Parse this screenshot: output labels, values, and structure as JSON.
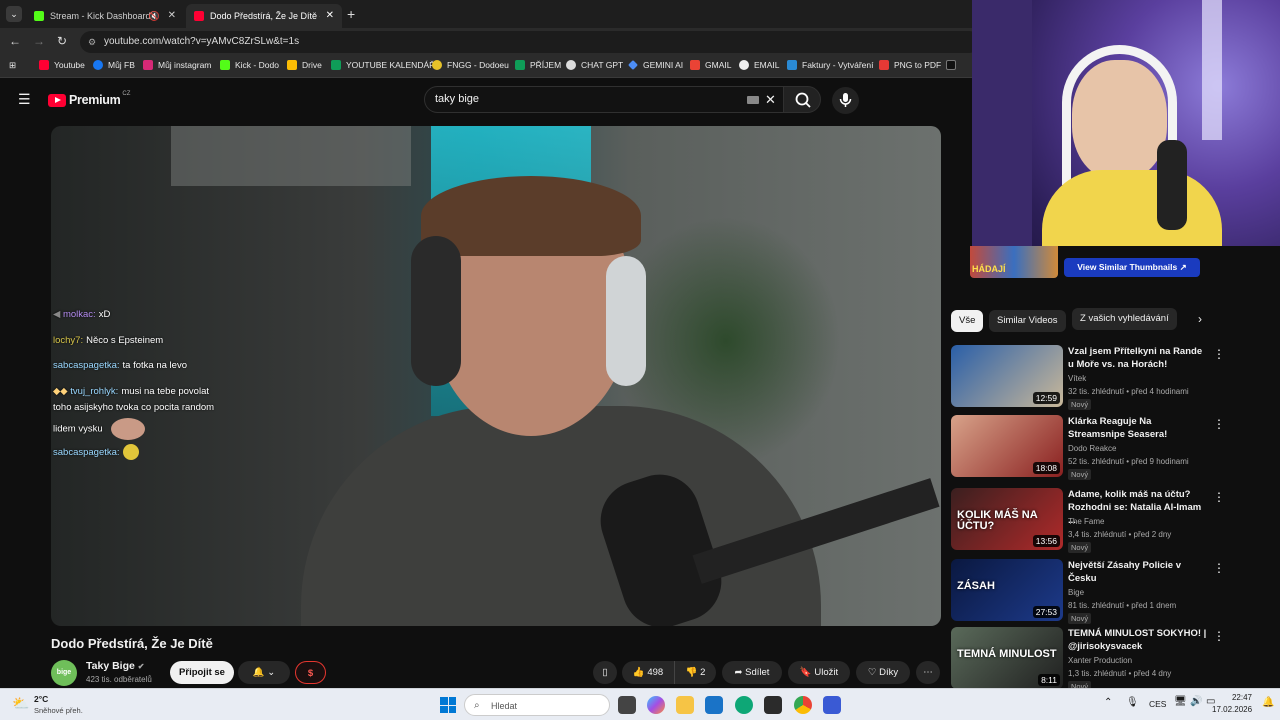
{
  "browser": {
    "tabs": [
      {
        "label": "Stream - Kick Dashboard"
      },
      {
        "label": "Dodo Předstírá, Že Je Dítě - You"
      }
    ],
    "url": "youtube.com/watch?v=yAMvC8ZrSLw&t=1s",
    "bookmarks": [
      "Youtube",
      "Můj FB",
      "Můj instagram",
      "Kick - Dodo",
      "Drive",
      "YOUTUBE KALENDÁŘ",
      "FNGG - Dodoeu",
      "PŘÍJEM",
      "CHAT GPT",
      "GEMINI AI",
      "GMAIL",
      "EMAIL",
      "Faktury - Vytváření",
      "PNG to PDF"
    ]
  },
  "youtube": {
    "logo": "Premium",
    "region": "CZ",
    "search_value": "taky bige"
  },
  "chat": [
    {
      "user": "molkac:",
      "msg": "xD",
      "color": "#b48cf0"
    },
    {
      "user": "lochy7:",
      "msg": "Něco s Epsteinem",
      "color": "#d8c64a"
    },
    {
      "user": "sabcaspagetka:",
      "msg": "ta fotka na levo",
      "color": "#9ad8ff"
    },
    {
      "user": "tvuj_rohlyk:",
      "msg": "musi na tebe povolat",
      "color": "#9ad8ff"
    },
    {
      "user": "",
      "msg": "toho asijskyho tvoka co pocita random",
      "color": "#fff"
    },
    {
      "user": "",
      "msg": "lidem vysku",
      "color": "#fff"
    },
    {
      "user": "sabcaspagetka:",
      "msg": "",
      "color": "#9ad8ff"
    }
  ],
  "video": {
    "title": "Dodo Předstírá, Že Je Dítě",
    "channel": "Taky Bige",
    "subscribers": "423 tis. odběratelů",
    "join_label": "Připojit se",
    "likes": "498",
    "dislikes": "2",
    "share_label": "Sdílet",
    "save_label": "Uložit",
    "thanks_label": "Díky"
  },
  "sidebar": {
    "similar_thumbs_btn": "View Similar Thumbnails",
    "thumb_caption": "HÁDAJÍ",
    "chips": [
      "Vše",
      "Similar Videos",
      "Z vašich vyhledávání"
    ],
    "videos": [
      {
        "title": "Vzal jsem Přítelkyni na Rande u Moře vs. na Horách!",
        "channel": "Vítek",
        "meta": "32 tis. zhlédnutí • před 4 hodinami",
        "badge": "Nový",
        "duration": "12:59",
        "colors": [
          "#2a5fa8",
          "#c9b89a"
        ],
        "thumb_text": ""
      },
      {
        "title": "Klárka Reaguje Na Streamsnipe Seasera!",
        "channel": "Dodo Reakce",
        "meta": "52 tis. zhlédnutí • před 9 hodinami",
        "badge": "Nový",
        "duration": "18:08",
        "colors": [
          "#d8a38a",
          "#8a2020"
        ],
        "thumb_text": ""
      },
      {
        "title": "Adame, kolik máš na účtu? Rozhodni se: Natalia Al-Imam ...",
        "channel": "The Fame",
        "meta": "3,4 tis. zhlédnutí • před 2 dny",
        "badge": "Nový",
        "duration": "13:56",
        "colors": [
          "#3a1f1f",
          "#b02a2a"
        ],
        "thumb_text": "KOLIK MÁŠ NA ÚČTU?"
      },
      {
        "title": "Největší Zásahy Policie v Česku",
        "channel": "Bige",
        "meta": "81 tis. zhlédnutí • před 1 dnem",
        "badge": "Nový",
        "duration": "27:53",
        "colors": [
          "#0a1840",
          "#1d3a8a"
        ],
        "thumb_text": "ZÁSAH"
      },
      {
        "title": "TEMNÁ MINULOST SOKYHO! | @jirisokysvacek",
        "channel": "Xanter Production",
        "meta": "1,3 tis. zhlédnutí • před 4 dny",
        "badge": "Nový",
        "duration": "8:11",
        "colors": [
          "#5a6a5a",
          "#202020"
        ],
        "thumb_text": "TEMNÁ MINULOST"
      }
    ]
  },
  "taskbar": {
    "weather_temp": "2°C",
    "weather_desc": "Sněhové přeh.",
    "search_placeholder": "Hledat",
    "lang": "CES",
    "time": "22:47",
    "date": "17.02.2026"
  }
}
